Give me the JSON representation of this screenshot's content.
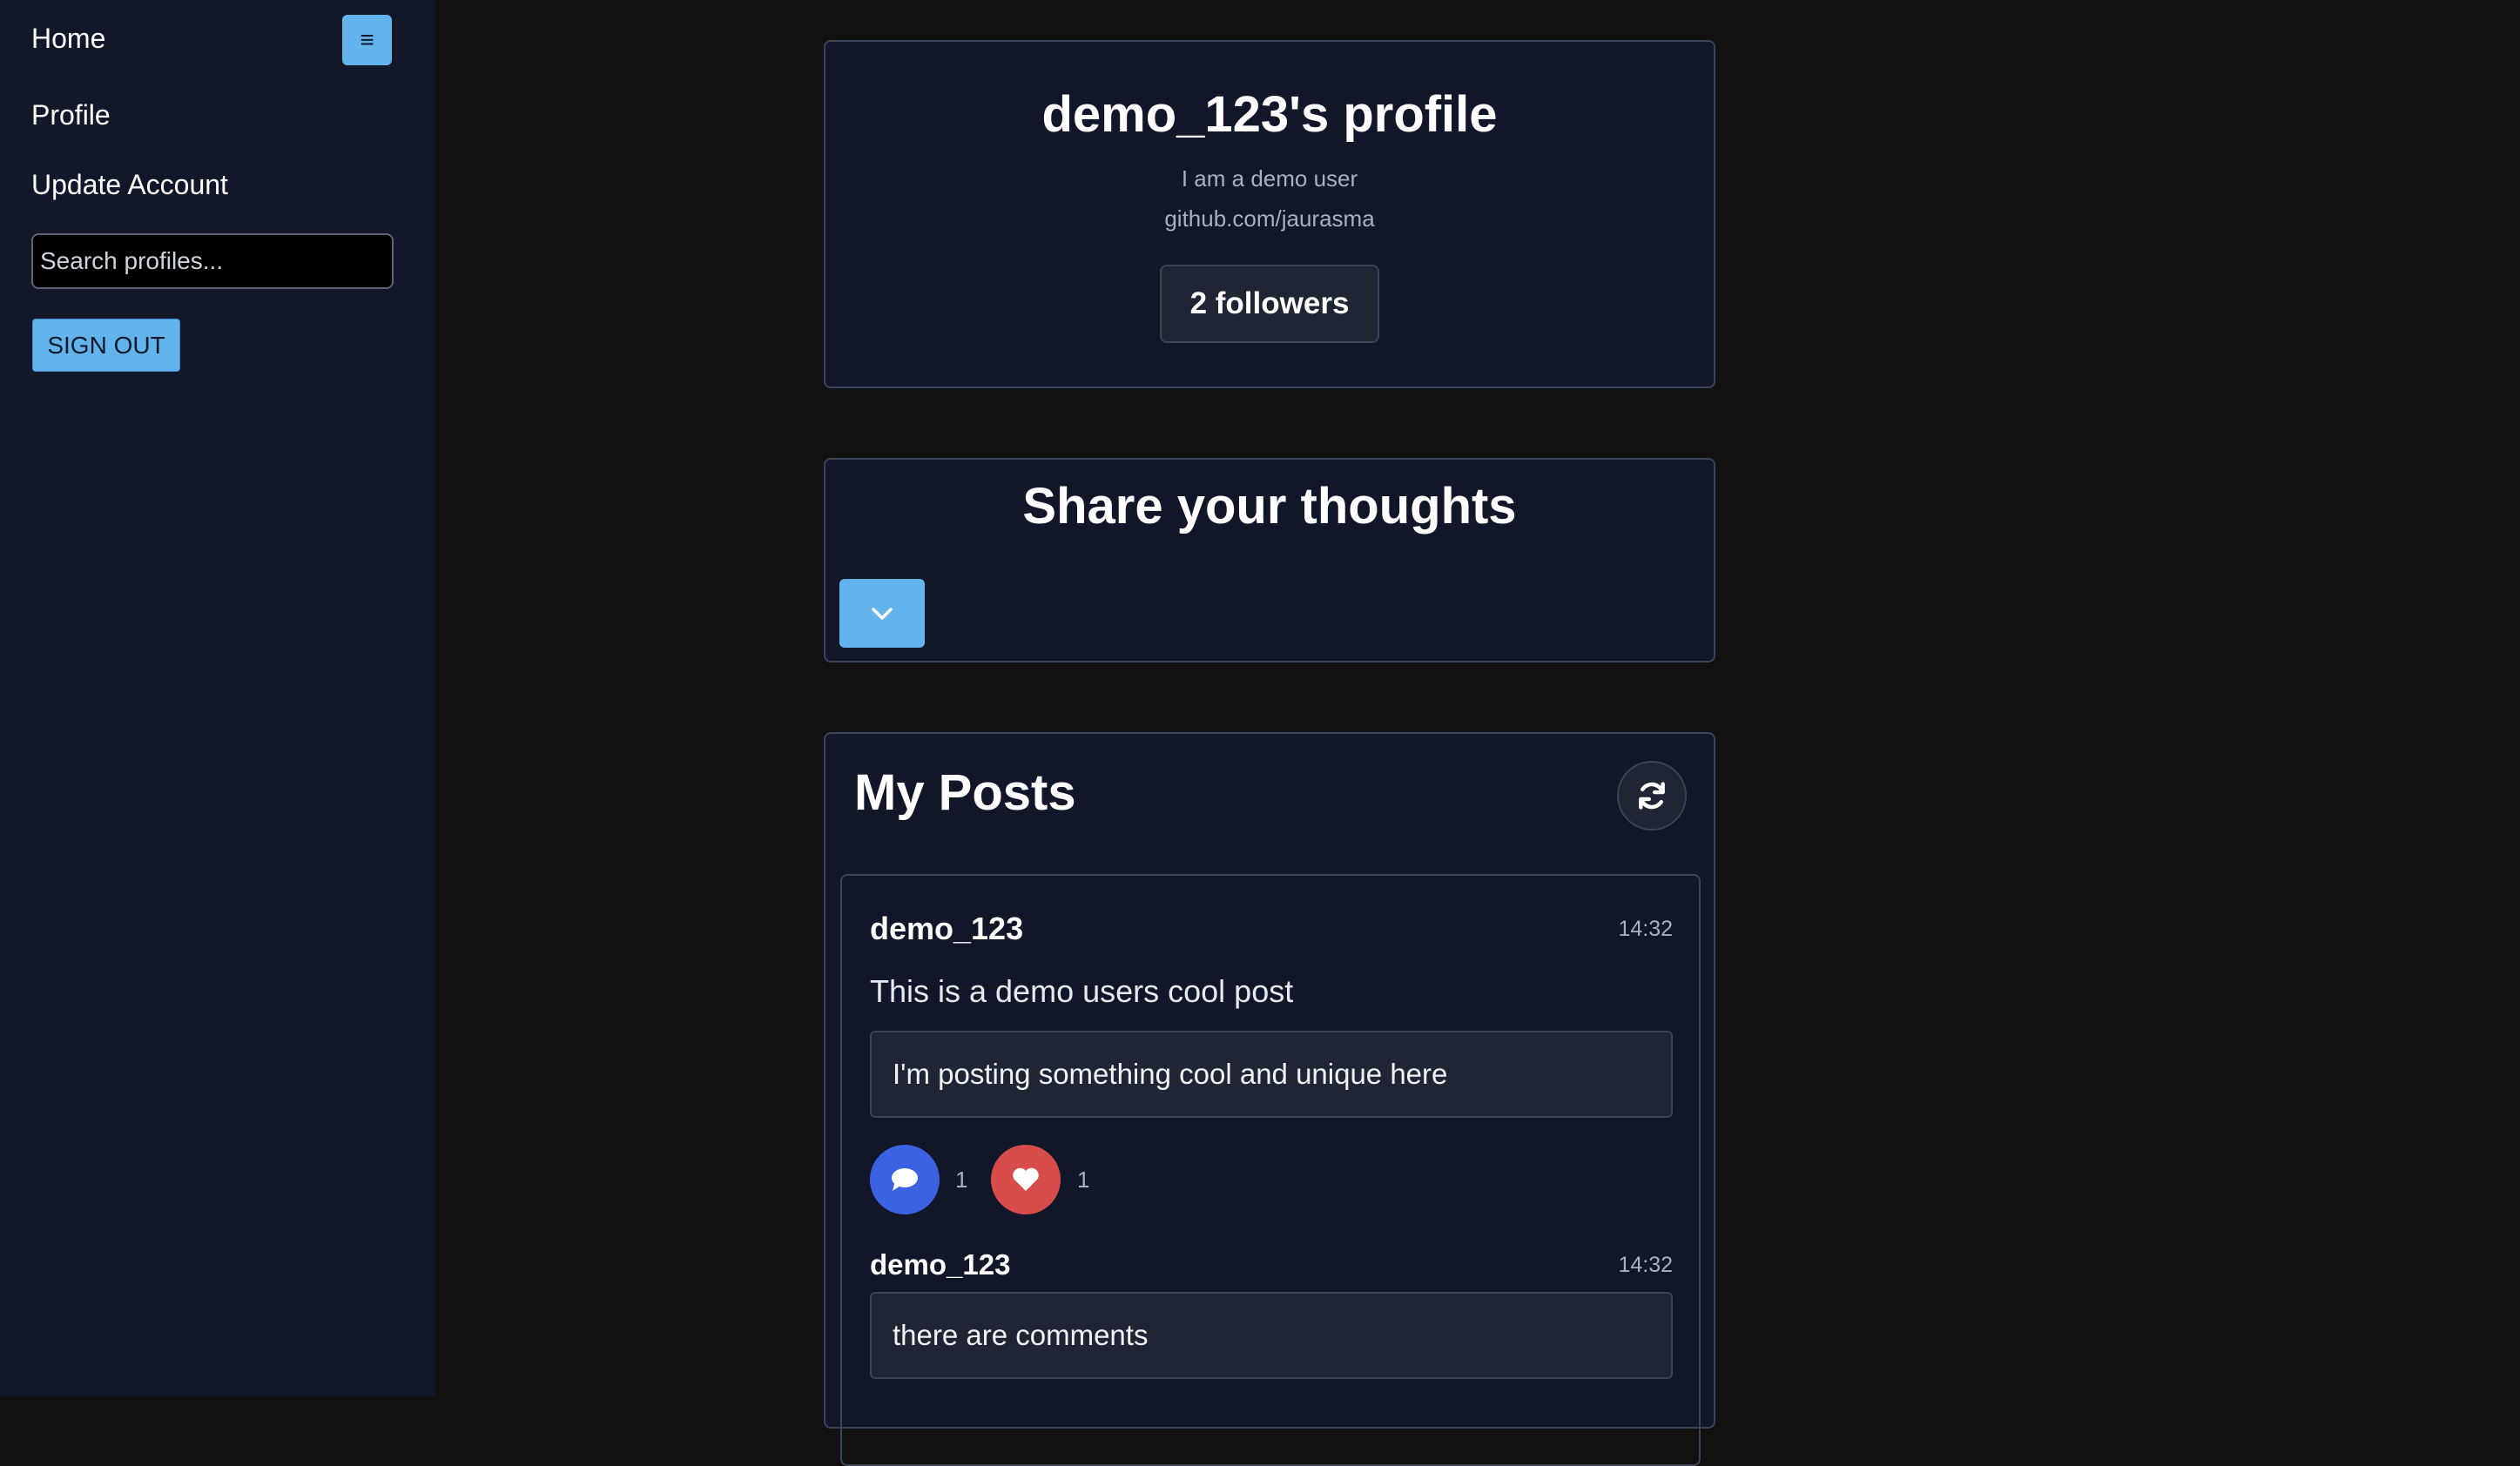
{
  "sidebar": {
    "home_label": "Home",
    "menu_icon": "≡",
    "profile_label": "Profile",
    "update_account_label": "Update Account",
    "search_placeholder": "Search profiles...",
    "signout_label": "SIGN OUT"
  },
  "profile": {
    "title": "demo_123's profile",
    "bio": "I am a demo user",
    "link": "github.com/jaurasma",
    "followers_label": "2 followers"
  },
  "share": {
    "title": "Share your thoughts"
  },
  "posts": {
    "title": "My Posts",
    "items": [
      {
        "author": "demo_123",
        "time": "14:32",
        "title": "This is a demo users cool post",
        "body": "I'm posting something cool and unique here",
        "comment_count": "1",
        "like_count": "1",
        "comments": [
          {
            "author": "demo_123",
            "time": "14:32",
            "text": "there are comments"
          }
        ]
      }
    ]
  },
  "colors": {
    "accent": "#63b3ed",
    "sidebar_bg": "#121829",
    "page_bg": "#111111",
    "card_bg": "#111629",
    "comment_button": "#3b62e0",
    "like_button": "#d94c4c"
  }
}
